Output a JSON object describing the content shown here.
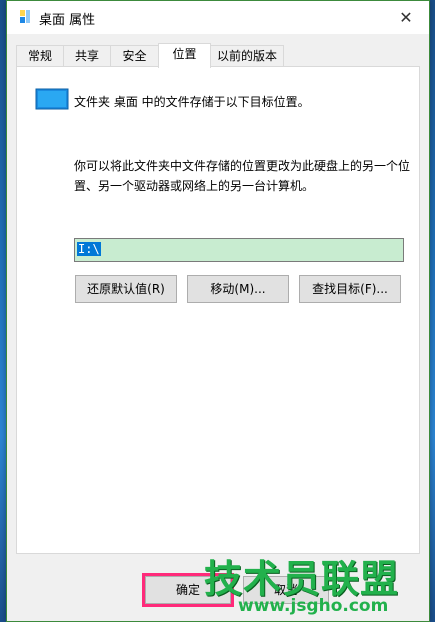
{
  "window": {
    "title": "桌面 属性",
    "close_glyph": "✕"
  },
  "tabs": [
    {
      "label": "常规"
    },
    {
      "label": "共享"
    },
    {
      "label": "安全"
    },
    {
      "label": "位置",
      "active": true
    },
    {
      "label": "以前的版本"
    }
  ],
  "location": {
    "folder_icon": "folder-desktop-icon",
    "description_line": "文件夹 桌面 中的文件存储于以下目标位置。",
    "explanation": "你可以将此文件夹中文件存储的位置更改为此硬盘上的另一个位置、另一个驱动器或网络上的另一台计算机。",
    "path_value": "I:\\"
  },
  "buttons": {
    "restore_default": "还原默认值(R)",
    "move": "移动(M)...",
    "find_target": "查找目标(F)..."
  },
  "footer": {
    "ok": "确定",
    "cancel": "取消"
  },
  "watermark": {
    "brand": "技术员联盟",
    "url": "www.jsgho.com"
  },
  "colors": {
    "window_border": "#3c8a3c",
    "selection": "#0078d7",
    "input_bg": "#c8ecd0",
    "highlight_box": "#ff2a7a",
    "watermark": "#22b14c"
  }
}
